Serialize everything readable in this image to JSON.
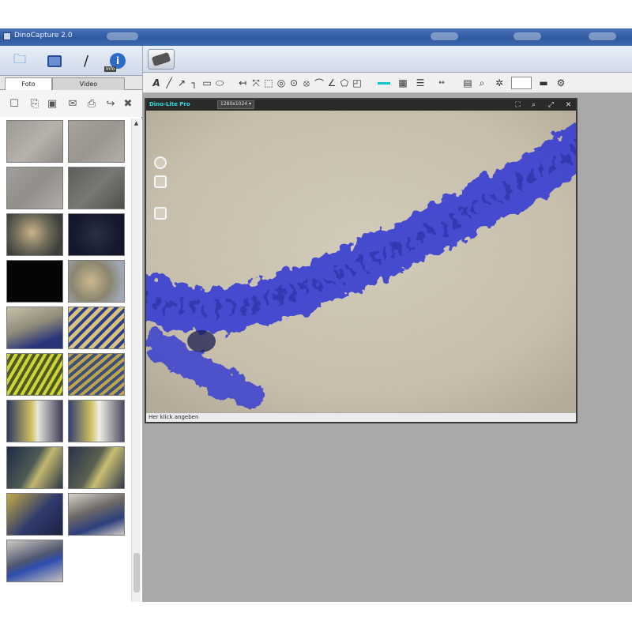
{
  "window": {
    "title": "DinoCapture 2.0"
  },
  "left_toolbar": {
    "info_label": "Info"
  },
  "tabs": [
    {
      "label": "Foto"
    },
    {
      "label": "Video"
    }
  ],
  "preview": {
    "device_label": "Dino-Lite Pro",
    "resolution": "1280x1024 ▾",
    "status": "Her klick angeben"
  },
  "colors": {
    "accent": "#11c5c5",
    "titlebar": "#2f5aa0",
    "workspace": "#a9a9a9",
    "stain": "#3a3fd0"
  },
  "thumbnails": [
    {
      "fill": "linear-gradient(135deg,#9e9a95,#b6b1ab 55%,#8f8b86)"
    },
    {
      "fill": "linear-gradient(135deg,#a8a49d,#9a958f 50%,#b3aea7)"
    },
    {
      "fill": "linear-gradient(135deg,#a2a09c,#918e8a 50%,#b0ada8)"
    },
    {
      "fill": "linear-gradient(135deg,#5f5d59,#7a7874 50%,#4f4e4b)"
    },
    {
      "fill": "radial-gradient(circle at 45% 45%,#c9b38a,#6f6b5a 45%,#3d3e3a 80%)"
    },
    {
      "fill": "radial-gradient(circle at 50% 50%,#2a2f45,#15182a 70%)"
    },
    {
      "fill": "#050505"
    },
    {
      "fill": "radial-gradient(circle at 40% 50%,#cbb88f,#8b8570 50%,#9fa8b5 85%)"
    },
    {
      "fill": "linear-gradient(160deg,#c8c2a8,#8f8b79 45%,#28337a 80%)"
    },
    {
      "fill": "repeating-linear-gradient(135deg,#d8c37a 0 5px,#2d3c8c 5px 9px)"
    },
    {
      "fill": "repeating-linear-gradient(120deg,#cfd23a 0 4px,#4d5b1e 4px 8px)"
    },
    {
      "fill": "repeating-linear-gradient(140deg,#bfa44c 0 4px,#3b4f7a 4px 8px)"
    },
    {
      "fill": "linear-gradient(90deg,#2b3760,#d4c463 45%,#e8e6d9 55%,#3d3c5a)"
    },
    {
      "fill": "linear-gradient(90deg,#334070,#cdbf60 40%,#f0efe8 55%,#4b4b60)"
    },
    {
      "fill": "linear-gradient(120deg,#1e2b45,#4c5a55 45%,#c2b770 60%,#2b3540)"
    },
    {
      "fill": "linear-gradient(120deg,#2a3348,#5a6050 45%,#c8bd72 60%,#30384a)"
    },
    {
      "fill": "linear-gradient(135deg,#c5aa44,#2e3a6e 55%,#1b2240)"
    },
    {
      "fill": "linear-gradient(160deg,#d7d3cc,#6e6a66 40%,#2d3f7c 70%,#cfcbc4)"
    },
    {
      "fill": "linear-gradient(160deg,#cfcac2,#4f5770 45%,#2e4db0 60%,#c7c2ba)"
    }
  ]
}
